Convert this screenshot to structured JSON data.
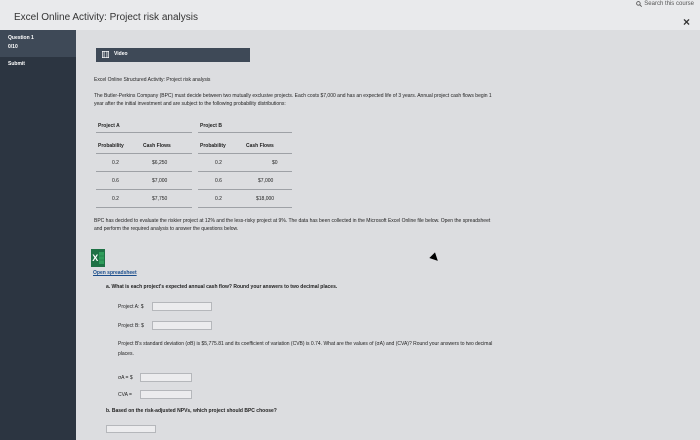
{
  "window": {
    "title": "Excel Online Activity: Project risk analysis",
    "search_text": "Search this course",
    "close_symbol": "×"
  },
  "sidebar": {
    "question_label": "Question 1",
    "question_score": "0/10",
    "submit_label": "Submit"
  },
  "video": {
    "label": "Video",
    "icon": "video-icon"
  },
  "activity_title": "Excel Online Structured Activity: Project risk analysis",
  "intro_line1": "The Butler-Perkins Company (BPC) must decide between two mutually exclusive projects. Each costs $7,000 and has an expected life of 3 years. Annual project cash flows begin 1",
  "intro_line2": "year after the initial investment and are subject to the following probability distributions:",
  "table": {
    "project_a_header": "Project A",
    "project_b_header": "Project B",
    "col_prob": "Probability",
    "col_cash": "Cash Flows",
    "rows_a": [
      {
        "prob": "0.2",
        "cash": "$6,250"
      },
      {
        "prob": "0.6",
        "cash": "$7,000"
      },
      {
        "prob": "0.2",
        "cash": "$7,750"
      }
    ],
    "rows_b": [
      {
        "prob": "0.2",
        "cash": "$0"
      },
      {
        "prob": "0.6",
        "cash": "$7,000"
      },
      {
        "prob": "0.2",
        "cash": "$18,000"
      }
    ]
  },
  "para2_line1": "BPC has decided to evaluate the riskier project at 12% and the less-risky project at 9%. The data has been collected in the Microsoft Excel Online file below. Open the spreadsheet",
  "para2_line2": "and perform the required analysis to answer the questions below.",
  "open_spreadsheet": "Open spreadsheet",
  "qa": {
    "prompt": "a. What is each project's expected annual cash flow? Round your answers to two decimal places.",
    "project_a_label": "Project A: $",
    "project_b_label": "Project B: $",
    "sd_line1": "Project B's standard deviation (σB) is $5,775.81 and its coefficient of variation (CVB) is 0.74. What are the values of (σA) and (CVA)? Round your answers to two decimal",
    "sd_line2": "places.",
    "sigma_label": "σA = $",
    "cv_label": "CVA ="
  },
  "qb": {
    "prompt": "b. Based on the risk-adjusted NPVs, which project should BPC choose?"
  }
}
